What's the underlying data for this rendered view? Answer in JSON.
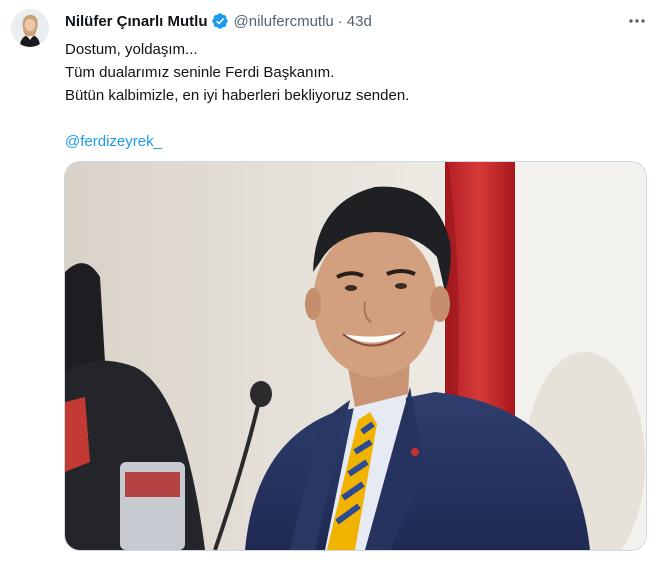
{
  "tweet": {
    "author_name": "Nilüfer Çınarlı Mutlu",
    "handle": "@nilufercmutlu",
    "separator": "·",
    "time": "43d",
    "lines": [
      "Dostum, yoldaşım...",
      "Tüm dualarımız seninle Ferdi Başkanım.",
      "Bütün kalbimizle, en iyi haberleri bekliyoruz senden."
    ],
    "mention": "@ferdizeyrek_"
  },
  "icons": {
    "verified": "verified-badge-icon",
    "more": "more-options-icon"
  },
  "colors": {
    "text": "#0f1419",
    "secondary": "#536471",
    "link": "#1d9bf0",
    "verified": "#1d9bf0",
    "border": "#cfd9de"
  }
}
